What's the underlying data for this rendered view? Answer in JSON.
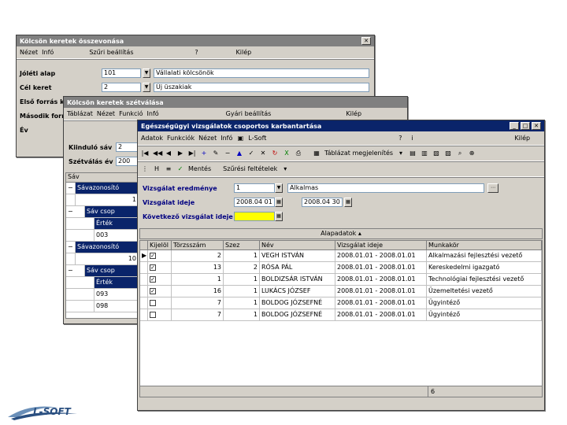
{
  "win1": {
    "title": "Kölcsön keretek összevonása",
    "menu": [
      "Nézet",
      "Infó",
      "Szűri beállítás",
      "Kilép"
    ],
    "labels": [
      "Jóléti alap",
      "Cél keret",
      "Első forrás ke",
      "Második forrá",
      "Év"
    ],
    "values": [
      "101",
      "2"
    ],
    "descs": [
      "Vállalati kölcsönök",
      "Új üszakiak"
    ]
  },
  "win2": {
    "title": "Kölcsön keretek szétválása",
    "menu": [
      "Táblázat",
      "Nézet",
      "Funkció",
      "Infó",
      "Gyári beállítás",
      "Kilép"
    ],
    "kiindulo_label": "Kiinduló sáv",
    "kiindulo_val": "2",
    "szetvalas_label": "Szétválás év",
    "szetvalas_val": "200",
    "tree_root": "Sáv",
    "tree": [
      {
        "h": "Sávazonosító",
        "v": "1"
      },
      {
        "h": "Sáv csop"
      },
      {
        "h": "Érték"
      },
      {
        "v": "003"
      },
      {
        "h": "Sávazonosító",
        "v": "10"
      },
      {
        "h": "Sáv csop"
      },
      {
        "h": "Érték"
      },
      {
        "v": "093"
      },
      {
        "v": "098"
      }
    ]
  },
  "win3": {
    "title": "Egészségügyi vizsgálatok csoportos karbantartása",
    "menu": [
      "Adatok",
      "Funkciók",
      "Nézet",
      "Infó",
      "L-Soft",
      "Kilép"
    ],
    "nav_label": "Táblázat megjelenítés",
    "sub": [
      "Mentés",
      "Szűrési feltételek"
    ],
    "f1_label": "Vizsgálat eredménye",
    "f1_val": "1",
    "f1_desc": "Alkalmas",
    "f2_label": "Vizsgálat ideje",
    "f2_from": "2008.04 01",
    "f2_to": "2008.04 30",
    "f3_label": "Következő vizsgálat ideje",
    "section": "Alapadatok",
    "cols": [
      "Kijelöl",
      "Törzsszám",
      "Szez",
      "Név",
      "Vizsgálat ideje",
      "Munkakör"
    ],
    "rows": [
      {
        "c": true,
        "t": "2",
        "s": "1",
        "n": "VEGH ISTVÁN",
        "d": "2008.01.01 - 2008.01.01",
        "m": "Alkalmazási fejlesztési vezető",
        "sel": true
      },
      {
        "c": true,
        "t": "13",
        "s": "2",
        "n": "RÓSA PÁL",
        "d": "2008.01.01 - 2008.01.01",
        "m": "Kereskedelmi igazgató"
      },
      {
        "c": true,
        "t": "1",
        "s": "1",
        "n": "BOLDIZSÁR ISTVÁN",
        "d": "2008.01.01 - 2008.01.01",
        "m": "Technológiai fejlesztési vezető"
      },
      {
        "c": true,
        "t": "16",
        "s": "1",
        "n": "LUKÁCS JÓZSEF",
        "d": "2008.01.01 - 2008.01.01",
        "m": "Üzemeltetési vezető"
      },
      {
        "c": false,
        "t": "7",
        "s": "1",
        "n": "BOLDOG JÓZSEFNÉ",
        "d": "2008.01.01 - 2008.01.01",
        "m": "Ügyintéző"
      },
      {
        "c": false,
        "t": "7",
        "s": "1",
        "n": "BOLDOG JÓZSEFNÉ",
        "d": "2008.01.01 - 2008.01.01",
        "m": "Ügyintéző"
      }
    ],
    "count": "6"
  },
  "logo": "L-SOFT"
}
